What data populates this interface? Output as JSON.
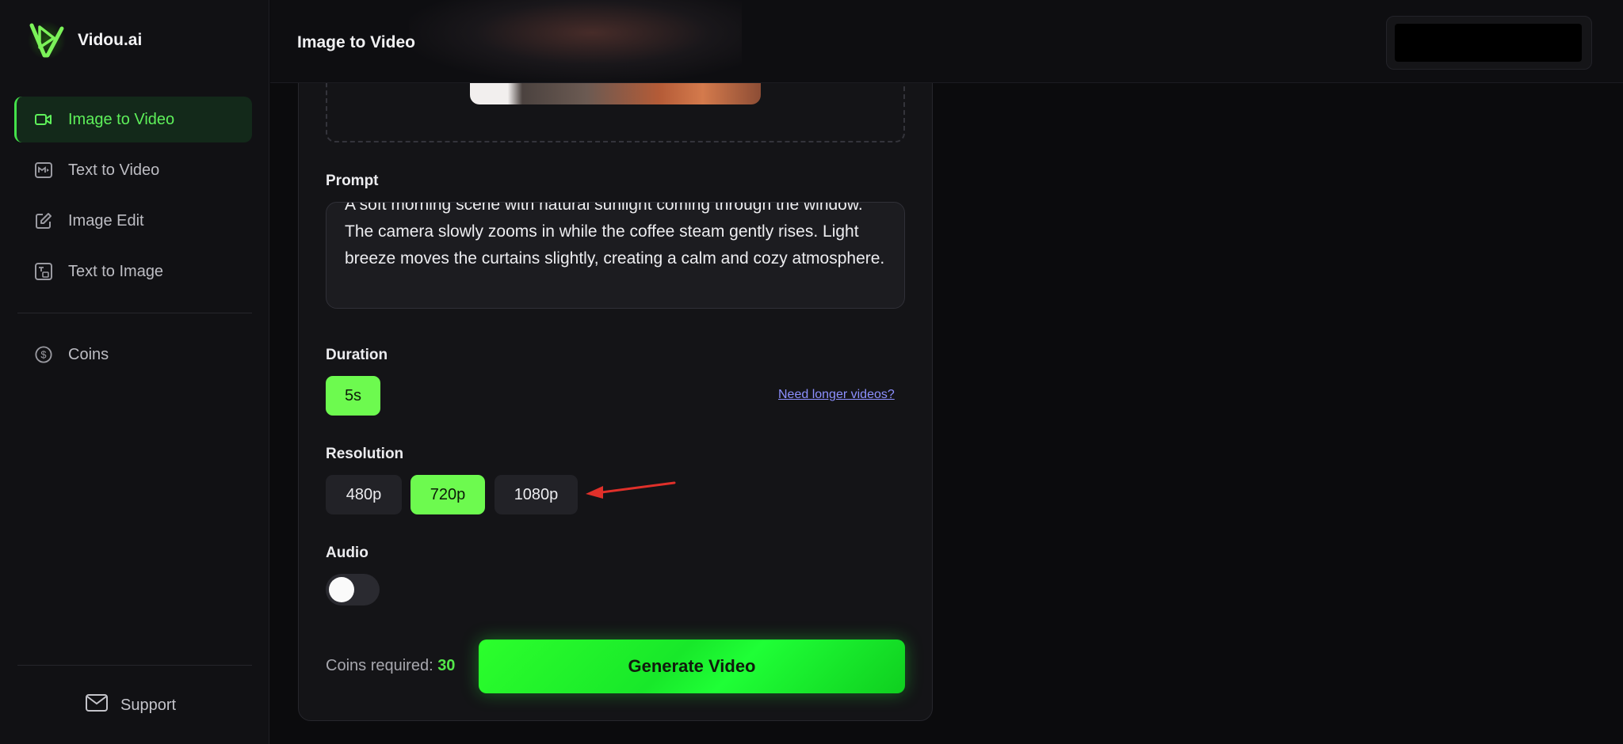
{
  "app": {
    "name": "Vidou.ai"
  },
  "header": {
    "title": "Image to Video"
  },
  "sidebar": {
    "items": [
      {
        "label": "Image to Video",
        "icon": "video-camera-icon",
        "active": true
      },
      {
        "label": "Text to Video",
        "icon": "text-video-icon",
        "active": false
      },
      {
        "label": "Image Edit",
        "icon": "edit-icon",
        "active": false
      },
      {
        "label": "Text to Image",
        "icon": "text-image-icon",
        "active": false
      }
    ],
    "coins": {
      "label": "Coins",
      "icon": "dollar-coin-icon"
    },
    "support": {
      "label": "Support",
      "icon": "mail-icon"
    }
  },
  "form": {
    "prompt": {
      "label": "Prompt",
      "value": "A soft morning scene with natural sunlight coming through the window. The camera slowly zooms in while the coffee steam gently rises. Light breeze moves the curtains slightly, creating a calm and cozy atmosphere."
    },
    "duration": {
      "label": "Duration",
      "options": [
        "5s"
      ],
      "selected": "5s",
      "longer_link": "Need longer videos?"
    },
    "resolution": {
      "label": "Resolution",
      "options": [
        "480p",
        "720p",
        "1080p"
      ],
      "selected": "720p"
    },
    "audio": {
      "label": "Audio",
      "enabled": false
    },
    "coins_required_label": "Coins required:",
    "coins_required_value": "30",
    "generate_label": "Generate Video"
  },
  "colors": {
    "accent": "#6dfa4f",
    "active_nav_bg": "#13291a",
    "annotation_arrow": "#e0302a"
  }
}
